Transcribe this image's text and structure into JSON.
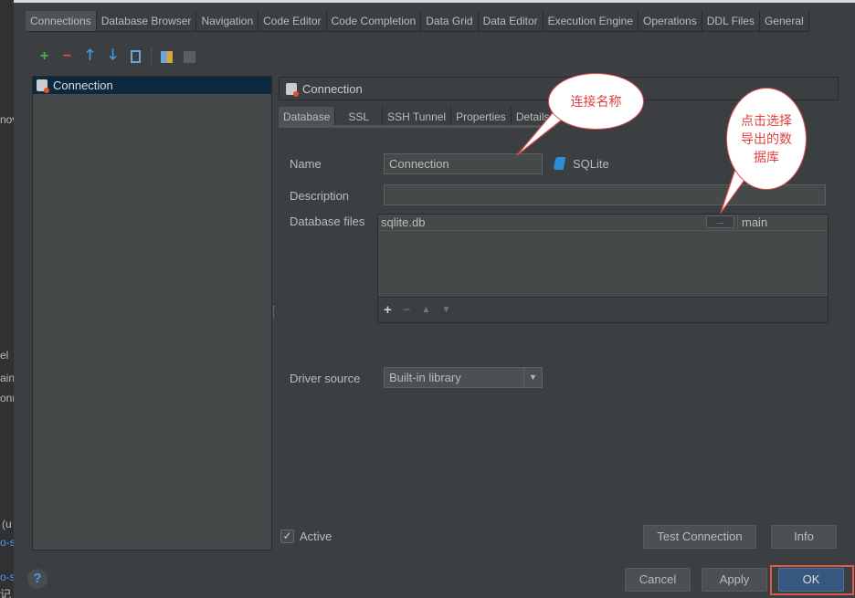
{
  "background_fragments": [
    "nov",
    "el",
    "ain",
    "onn",
    "(u",
    "o-s",
    "o-s",
    "记"
  ],
  "tabs": [
    "Connections",
    "Database Browser",
    "Navigation",
    "Code Editor",
    "Code Completion",
    "Data Grid",
    "Data Editor",
    "Execution Engine",
    "Operations",
    "DDL Files",
    "General"
  ],
  "toolbar": [
    "add-icon",
    "remove-icon",
    "move-up-icon",
    "move-down-icon",
    "copy-icon",
    "import-icon",
    "export-icon"
  ],
  "tree": {
    "items": [
      {
        "label": "Connection"
      }
    ]
  },
  "header": {
    "title": "Connection"
  },
  "subtabs": [
    "Database",
    "SSL",
    "SSH Tunnel",
    "Properties",
    "Details"
  ],
  "form": {
    "name_label": "Name",
    "name_value": "Connection",
    "db_type": "SQLite",
    "description_label": "Description",
    "description_value": "",
    "files_label": "Database files",
    "files": [
      {
        "path": "sqlite.db",
        "browse": "...",
        "schema": "main"
      }
    ],
    "driver_label": "Driver source",
    "driver_value": "Built-in library"
  },
  "active": {
    "label": "Active",
    "checked": true
  },
  "buttons": {
    "test": "Test Connection",
    "info": "Info",
    "cancel": "Cancel",
    "apply": "Apply",
    "ok": "OK",
    "help": "?"
  },
  "annotations": {
    "name": "连接名称",
    "files": "点击选择导出的数据库"
  },
  "colors": {
    "accent": "#365880",
    "highlight": "#e05050",
    "selection": "#0d293e"
  }
}
